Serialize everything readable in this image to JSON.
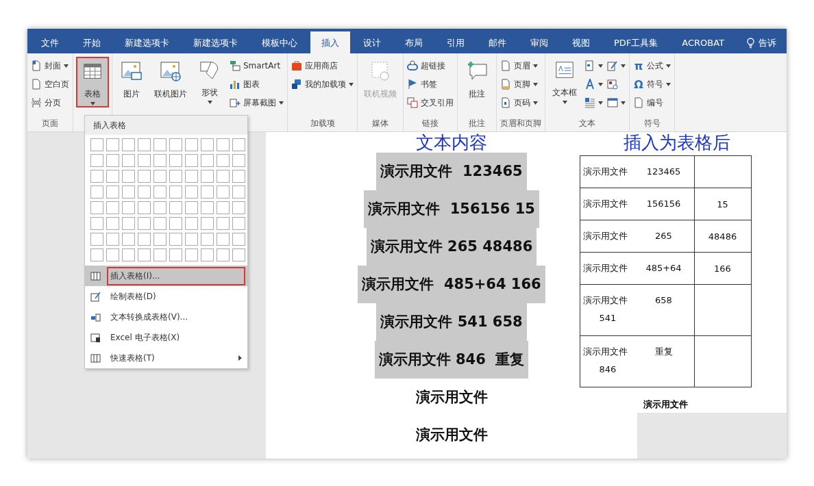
{
  "tabs": [
    {
      "label": "文件",
      "selected": false
    },
    {
      "label": "开始",
      "selected": false
    },
    {
      "label": "新建选项卡",
      "selected": false
    },
    {
      "label": "新建选项卡",
      "selected": false
    },
    {
      "label": "模板中心",
      "selected": false
    },
    {
      "label": "插入",
      "selected": true
    },
    {
      "label": "设计",
      "selected": false
    },
    {
      "label": "布局",
      "selected": false
    },
    {
      "label": "引用",
      "selected": false
    },
    {
      "label": "邮件",
      "selected": false
    },
    {
      "label": "审阅",
      "selected": false
    },
    {
      "label": "视图",
      "selected": false
    },
    {
      "label": "PDF工具集",
      "selected": false
    },
    {
      "label": "ACROBAT",
      "selected": false
    }
  ],
  "tell_me": "告诉",
  "ribbon_groups": [
    {
      "label": "页面",
      "columns": [
        {
          "kind": "stack",
          "items": [
            {
              "label": "封面",
              "caret": true
            },
            {
              "label": "空白页",
              "caret": false
            },
            {
              "label": "分页",
              "caret": false
            }
          ]
        }
      ]
    },
    {
      "columns": [
        {
          "kind": "large",
          "label": "表格",
          "caret": true,
          "pressed": true,
          "disabled": false
        }
      ]
    },
    {
      "columns": [
        {
          "kind": "large",
          "label": "图片",
          "caret": false,
          "pressed": false,
          "disabled": false
        },
        {
          "kind": "large",
          "label": "联机图片",
          "caret": false,
          "pressed": false,
          "disabled": false
        },
        {
          "kind": "large",
          "label": "形状",
          "caret": true,
          "pressed": false,
          "disabled": false
        },
        {
          "kind": "stack",
          "items": [
            {
              "label": "SmartArt",
              "caret": false
            },
            {
              "label": "图表",
              "caret": false
            },
            {
              "label": "屏幕截图",
              "caret": true
            }
          ]
        }
      ]
    },
    {
      "label": "加载项",
      "columns": [
        {
          "kind": "stack",
          "items": [
            {
              "label": "应用商店",
              "caret": false
            },
            {
              "label": "我的加载项",
              "caret": true
            }
          ]
        }
      ]
    },
    {
      "label": "媒体",
      "columns": [
        {
          "kind": "large",
          "label": "联机视频",
          "caret": false,
          "pressed": false,
          "disabled": true
        }
      ]
    },
    {
      "label": "链接",
      "columns": [
        {
          "kind": "stack",
          "items": [
            {
              "label": "超链接",
              "caret": false
            },
            {
              "label": "书签",
              "caret": false
            },
            {
              "label": "交叉引用",
              "caret": false
            }
          ]
        }
      ]
    },
    {
      "label": "批注",
      "columns": [
        {
          "kind": "large",
          "label": "批注",
          "caret": false,
          "pressed": false,
          "disabled": false
        }
      ]
    },
    {
      "label": "页眉和页脚",
      "columns": [
        {
          "kind": "stack",
          "items": [
            {
              "label": "页眉",
              "caret": true
            },
            {
              "label": "页脚",
              "caret": true
            },
            {
              "label": "页码",
              "caret": true
            }
          ]
        }
      ]
    },
    {
      "label": "文本",
      "columns": [
        {
          "kind": "large",
          "label": "文本框",
          "caret": true,
          "pressed": false,
          "disabled": false
        },
        {
          "kind": "stack",
          "items": [
            {
              "caret": true
            },
            {
              "caret": true
            },
            {
              "caret": true
            }
          ]
        },
        {
          "kind": "stack",
          "items": [
            {
              "caret": true
            },
            {
              "caret": false
            },
            {
              "caret": true
            }
          ]
        }
      ]
    },
    {
      "label": "符号",
      "columns": [
        {
          "kind": "stack",
          "items": [
            {
              "glyph": "π",
              "label": "公式",
              "caret": true
            },
            {
              "glyph": "Ω",
              "label": "符号",
              "caret": true
            },
            {
              "label": "编号",
              "caret": false
            }
          ]
        }
      ]
    }
  ],
  "table_menu": {
    "title": "插入表格",
    "items": [
      {
        "label": "插入表格(I)...",
        "selected": true,
        "submenu": false
      },
      {
        "label": "绘制表格(D)",
        "selected": false,
        "submenu": false
      },
      {
        "label": "文本转换成表格(V)...",
        "selected": false,
        "submenu": false
      },
      {
        "label": "Excel 电子表格(X)",
        "selected": false,
        "submenu": false
      },
      {
        "label": "快速表格(T)",
        "selected": false,
        "submenu": true
      }
    ]
  },
  "document": {
    "heading": "文本内容",
    "lines": [
      {
        "text": "演示用文件  123465",
        "highlighted": true
      },
      {
        "text": "演示用文件  156156 15",
        "highlighted": true
      },
      {
        "text": "演示用文件 265 48486",
        "highlighted": true
      },
      {
        "text": "演示用文件  485+64 166",
        "highlighted": true
      },
      {
        "text": "演示用文件 541 658",
        "highlighted": true
      },
      {
        "text": "演示用文件 846  重复",
        "highlighted": true
      },
      {
        "text": "演示用文件",
        "highlighted": false
      },
      {
        "text": "演示用文件",
        "highlighted": false
      }
    ]
  },
  "result": {
    "heading": "插入为表格后",
    "rows": [
      {
        "lines": [
          [
            "演示用文件",
            "123465"
          ]
        ],
        "last": ""
      },
      {
        "lines": [
          [
            "演示用文件",
            "156156"
          ]
        ],
        "last": "15"
      },
      {
        "lines": [
          [
            "演示用文件",
            "265"
          ]
        ],
        "last": "48486"
      },
      {
        "lines": [
          [
            "演示用文件",
            "485+64"
          ]
        ],
        "last": "166"
      },
      {
        "lines": [
          [
            "演示用文件",
            "658"
          ],
          [
            "541"
          ]
        ],
        "last": ""
      },
      {
        "lines": [
          [
            "演示用文件",
            "重复"
          ],
          [
            "846"
          ]
        ],
        "last": ""
      }
    ],
    "after": "演示用文件"
  }
}
